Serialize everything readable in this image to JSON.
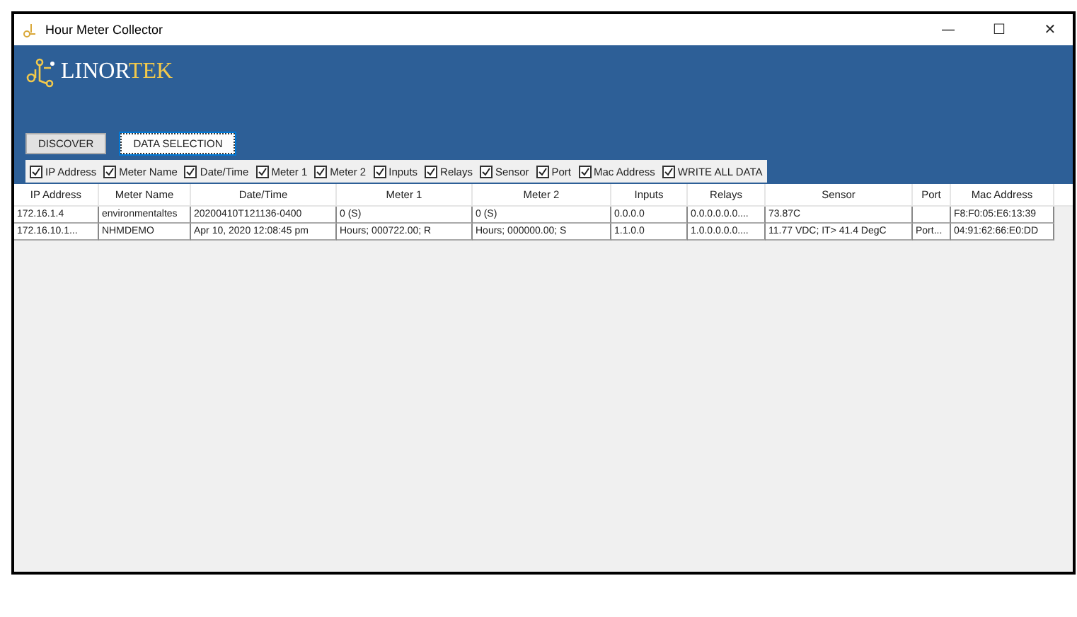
{
  "window": {
    "title": "Hour Meter Collector",
    "controls": [
      "—",
      "☐",
      "✕"
    ]
  },
  "logo": {
    "parts": [
      "LINOR",
      "TEK"
    ]
  },
  "buttons": [
    {
      "label": "DISCOVER",
      "selected": false
    },
    {
      "label": "DATA SELECTION",
      "selected": true
    }
  ],
  "fields": [
    {
      "label": "IP Address",
      "checked": true
    },
    {
      "label": "Meter Name",
      "checked": true
    },
    {
      "label": "Date/Time",
      "checked": true
    },
    {
      "label": "Meter 1",
      "checked": true
    },
    {
      "label": "Meter 2",
      "checked": true
    },
    {
      "label": "Inputs",
      "checked": true
    },
    {
      "label": "Relays",
      "checked": true
    },
    {
      "label": "Sensor",
      "checked": true
    },
    {
      "label": "Port",
      "checked": true
    },
    {
      "label": "Mac Address",
      "checked": true
    },
    {
      "label": "WRITE ALL DATA",
      "checked": true
    }
  ],
  "table": {
    "columns": [
      "IP Address",
      "Meter Name",
      "Date/Time",
      "Meter 1",
      "Meter 2",
      "Inputs",
      "Relays",
      "Sensor",
      "Port",
      "Mac Address"
    ],
    "rows": [
      [
        "172.16.1.4",
        "environmentaltes",
        "20200410T121136-0400",
        "0 (S)",
        "0 (S)",
        "0.0.0.0",
        "0.0.0.0.0.0....",
        "73.87C",
        "",
        "F8:F0:05:E6:13:39"
      ],
      [
        "172.16.10.1...",
        "NHMDEMO",
        "Apr 10, 2020  12:08:45 pm",
        "Hours; 000722.00; R",
        "Hours; 000000.00; S",
        "1.1.0.0",
        "1.0.0.0.0.0....",
        "11.77 VDC; IT> 41.4 DegC",
        "Port...",
        "04:91:62:66:E0:DD"
      ]
    ]
  }
}
